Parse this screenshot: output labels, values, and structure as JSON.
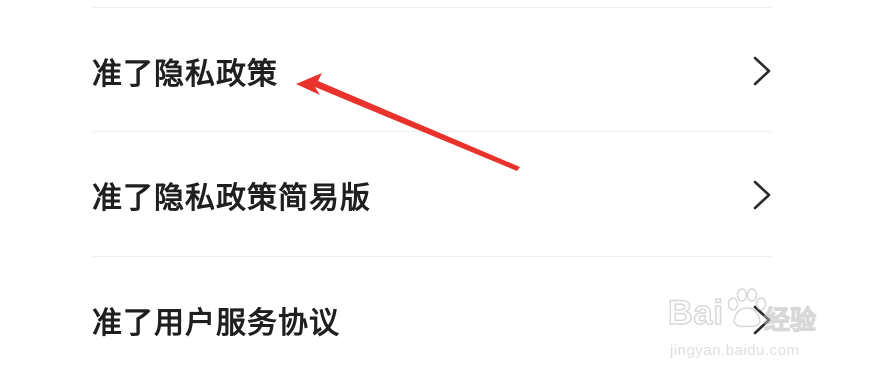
{
  "settings": {
    "items": [
      {
        "label": "准了隐私政策",
        "icon": "chevron-right-icon"
      },
      {
        "label": "准了隐私政策简易版",
        "icon": "chevron-right-icon"
      },
      {
        "label": "准了用户服务协议",
        "icon": "chevron-right-icon"
      }
    ]
  },
  "annotation": {
    "color": "#e8322b"
  },
  "watermark": {
    "brand": "Bai",
    "brand_cn": "经验",
    "url": "jingyan.baidu.com",
    "icon": "paw-icon"
  }
}
